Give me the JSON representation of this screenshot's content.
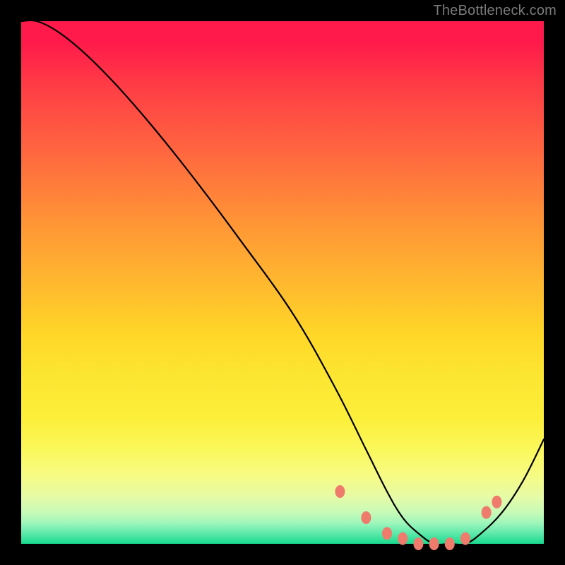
{
  "attribution": "TheBottleneck.com",
  "chart_data": {
    "type": "line",
    "title": "",
    "xlabel": "",
    "ylabel": "",
    "xlim": [
      0,
      100
    ],
    "ylim": [
      0,
      100
    ],
    "y_axis_meaning": "bottleneck percentage (high = red/top, 0 = green/bottom)",
    "series": [
      {
        "name": "bottleneck-curve",
        "x": [
          0,
          3,
          7,
          12,
          18,
          25,
          33,
          42,
          52,
          60,
          66,
          70,
          73,
          76,
          79,
          82,
          85,
          88,
          92,
          96,
          100
        ],
        "y": [
          100,
          100,
          98,
          94,
          88,
          80,
          70,
          58,
          44,
          30,
          18,
          10,
          5,
          2,
          0,
          0,
          0,
          2,
          6,
          12,
          20
        ]
      }
    ],
    "markers": {
      "name": "highlight-dots",
      "color": "#ef7b6c",
      "points": [
        {
          "x": 61,
          "y": 10
        },
        {
          "x": 66,
          "y": 5
        },
        {
          "x": 70,
          "y": 2
        },
        {
          "x": 73,
          "y": 1
        },
        {
          "x": 76,
          "y": 0
        },
        {
          "x": 79,
          "y": 0
        },
        {
          "x": 82,
          "y": 0
        },
        {
          "x": 85,
          "y": 1
        },
        {
          "x": 89,
          "y": 6
        },
        {
          "x": 91,
          "y": 8
        }
      ]
    },
    "background_gradient_meaning": "rainbow heat scale from green (good / low bottleneck) at bottom to magenta-red (bad / high bottleneck) at top"
  }
}
